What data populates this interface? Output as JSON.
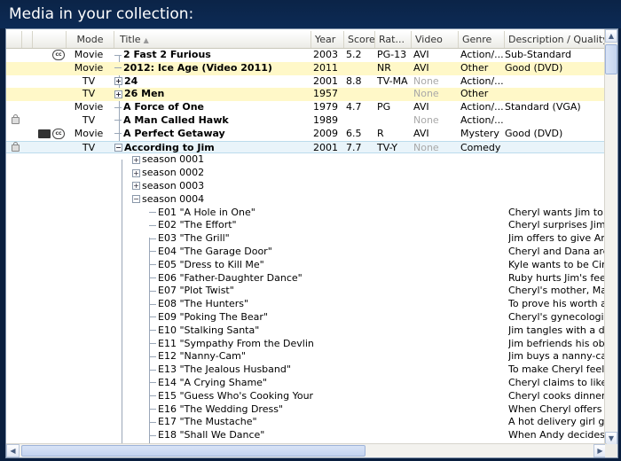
{
  "header": {
    "title": "Media in your collection:"
  },
  "columns": {
    "mode": "Mode",
    "title": "Title",
    "year": "Year",
    "score": "Score",
    "rating": "Rat...",
    "video": "Video",
    "genre": "Genre",
    "desc": "Description / Quality"
  },
  "rows": [
    {
      "title": "2 Fast 2 Furious",
      "mode": "Movie",
      "year": "2003",
      "score": "5.2",
      "rating": "PG-13",
      "video": "AVI",
      "genre": "Action/...",
      "desc": "Sub-Standard",
      "icons": [
        "cc"
      ]
    },
    {
      "title": "2012: Ice Age (Video 2011)",
      "mode": "Movie",
      "year": "2011",
      "score": "",
      "rating": "NR",
      "video": "AVI",
      "genre": "Other",
      "desc": "Good (DVD)",
      "icons": []
    },
    {
      "title": "24",
      "mode": "TV",
      "year": "2001",
      "score": "8.8",
      "rating": "TV-MA",
      "video": "None",
      "genre": "Action/...",
      "desc": "",
      "icons": []
    },
    {
      "title": "26 Men",
      "mode": "TV",
      "year": "1957",
      "score": "",
      "rating": "",
      "video": "None",
      "genre": "Other",
      "desc": "",
      "icons": []
    },
    {
      "title": "A Force of One",
      "mode": "Movie",
      "year": "1979",
      "score": "4.7",
      "rating": "PG",
      "video": "AVI",
      "genre": "Action/...",
      "desc": "Standard (VGA)",
      "icons": []
    },
    {
      "title": "A Man Called Hawk",
      "mode": "TV",
      "year": "1989",
      "score": "",
      "rating": "",
      "video": "None",
      "genre": "Action/...",
      "desc": "",
      "icons": [
        "lock"
      ]
    },
    {
      "title": "A Perfect Getaway",
      "mode": "Movie",
      "year": "2009",
      "score": "6.5",
      "rating": "R",
      "video": "AVI",
      "genre": "Mystery",
      "desc": "Good (DVD)",
      "icons": [
        "film",
        "cc"
      ]
    },
    {
      "title": "According to Jim",
      "mode": "TV",
      "year": "2001",
      "score": "7.7",
      "rating": "TV-Y",
      "video": "None",
      "genre": "Comedy",
      "desc": "",
      "icons": [
        "lock"
      ]
    }
  ],
  "seasons": [
    "season 0001",
    "season 0002",
    "season 0003",
    "season 0004"
  ],
  "episodes": [
    {
      "num": "E01",
      "title": "\"A Hole in One\"",
      "desc": "Cheryl wants Jim to give"
    },
    {
      "num": "E02",
      "title": "\"The Effort\"",
      "desc": "Cheryl surprises Jim with"
    },
    {
      "num": "E03",
      "title": "\"The Grill\"",
      "desc": "Jim offers to give Andy ."
    },
    {
      "num": "E04",
      "title": "\"The Garage Door\"",
      "desc": "Cheryl and Dana are ford"
    },
    {
      "num": "E05",
      "title": "\"Dress to Kill Me\"",
      "desc": "Kyle wants to be Cinder"
    },
    {
      "num": "E06",
      "title": "\"Father-Daughter Dance\"",
      "desc": "Ruby hurts Jim's feelings"
    },
    {
      "num": "E07",
      "title": "\"Plot Twist\"",
      "desc": "Cheryl's mother, Maggie"
    },
    {
      "num": "E08",
      "title": "\"The Hunters\"",
      "desc": "To prove his worth as a"
    },
    {
      "num": "E09",
      "title": "\"Poking The Bear\"",
      "desc": "Cheryl's gynecologist (pl"
    },
    {
      "num": "E10",
      "title": "\"Stalking Santa\"",
      "desc": "Jim tangles with a depar"
    },
    {
      "num": "E11",
      "title": "\"Sympathy From the Devlins\"",
      "desc": "Jim befriends his obnoxi"
    },
    {
      "num": "E12",
      "title": "\"Nanny-Cam\"",
      "desc": "Jim buys a nanny-cam to"
    },
    {
      "num": "E13",
      "title": "\"The Jealous Husband\"",
      "desc": "To make Cheryl feel des"
    },
    {
      "num": "E14",
      "title": "\"A Crying Shame\"",
      "desc": "Cheryl claims to like mer"
    },
    {
      "num": "E15",
      "title": "\"Guess Who's Cooking Your ...",
      "desc": "Cheryl cooks dinner for D"
    },
    {
      "num": "E16",
      "title": "\"The Wedding Dress\"",
      "desc": "When Cheryl offers Dana"
    },
    {
      "num": "E17",
      "title": "\"The Mustache\"",
      "desc": "A hot delivery girl gives ."
    },
    {
      "num": "E18",
      "title": "\"Shall We Dance\"",
      "desc": "When Andy decides to l"
    }
  ],
  "colors": {
    "header_bg": "#0b2447",
    "highlight_row": "#fff8c8",
    "selected_row": "#e9f4fa"
  }
}
